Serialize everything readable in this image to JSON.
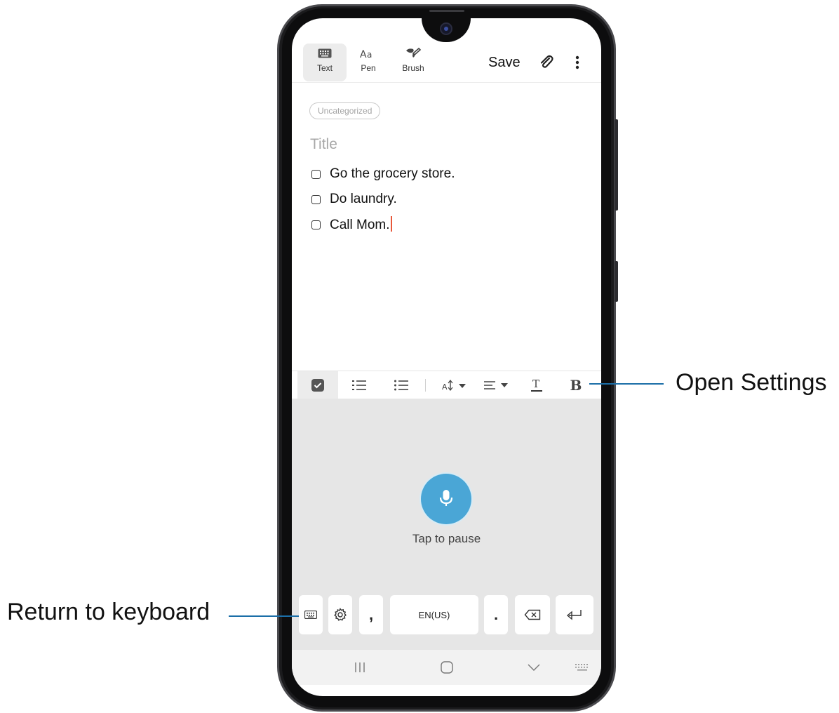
{
  "toolbar": {
    "tools": [
      {
        "label": "Text",
        "icon": "keyboard-icon",
        "active": true
      },
      {
        "label": "Pen",
        "icon": "pen-text-icon",
        "active": false
      },
      {
        "label": "Brush",
        "icon": "brush-icon",
        "active": false
      }
    ],
    "save_label": "Save",
    "attach_icon": "paperclip-icon",
    "more_icon": "more-vert-icon"
  },
  "note": {
    "category": "Uncategorized",
    "title_placeholder": "Title",
    "items": [
      {
        "text": "Go the grocery store."
      },
      {
        "text": "Do laundry."
      },
      {
        "text": "Call Mom."
      }
    ]
  },
  "format_bar": {
    "buttons": [
      "checkbox-list-icon",
      "numbered-list-icon",
      "bullet-list-icon",
      "font-size-icon",
      "align-icon",
      "text-color-icon",
      "bold-icon"
    ],
    "bold_glyph": "B"
  },
  "voice": {
    "mic_icon": "microphone-icon",
    "status": "Tap to pause",
    "mic_color": "#4aa6d6"
  },
  "keyboard": {
    "comma": ",",
    "language": "EN(US)",
    "period": "."
  },
  "callouts": {
    "open_settings": "Open Settings",
    "return_to_keyboard": "Return to keyboard"
  },
  "colors": {
    "accent_line": "#1c6fa8",
    "caret": "#e8583a"
  }
}
